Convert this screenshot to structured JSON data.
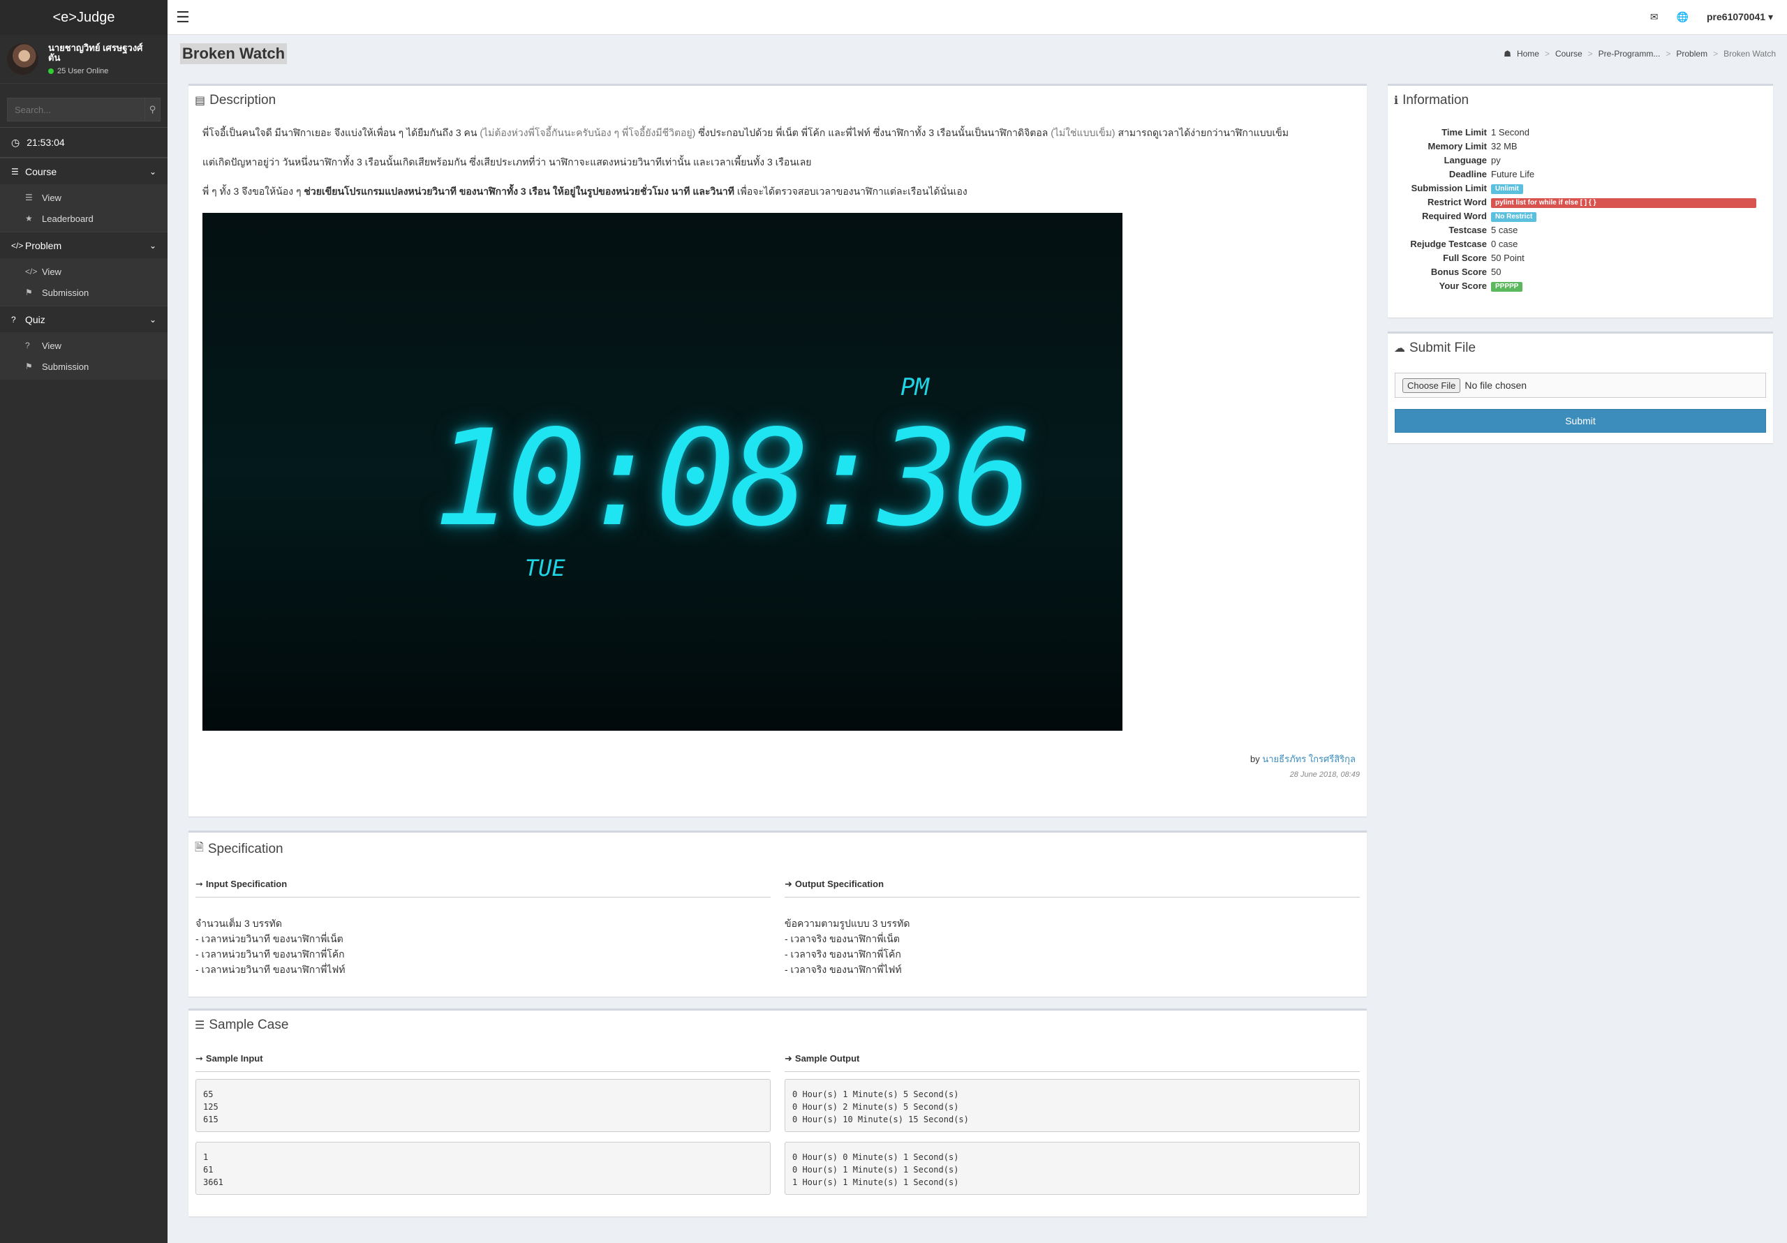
{
  "sidebar": {
    "brand": "<e>Judge",
    "user_name_line1": "นายชาญวิทย์ เศรษฐวงศ์",
    "user_name_line2": "ตัน",
    "online": "25 User Online",
    "search_placeholder": "Search...",
    "clock": "21:53:04",
    "menus": [
      {
        "label": "Course",
        "items": [
          "View",
          "Leaderboard"
        ]
      },
      {
        "label": "Problem",
        "items": [
          "View",
          "Submission"
        ]
      },
      {
        "label": "Quiz",
        "items": [
          "View",
          "Submission"
        ]
      }
    ]
  },
  "topbar": {
    "username": "pre61070041"
  },
  "page": {
    "title": "Broken Watch",
    "breadcrumb": [
      "Home",
      "Course",
      "Pre-Programm...",
      "Problem",
      "Broken Watch"
    ]
  },
  "description": {
    "heading": "Description",
    "p1_a": "พี่โจอี้เป็นคนใจดี มีนาฬิกาเยอะ จึงแบ่งให้เพื่อน ๆ ได้ยืมกันถึง 3 คน ",
    "p1_b": "(ไม่ต้องห่วงพี่โจอี้กันนะครับน้อง ๆ พี่โจอี้ยังมีชีวิตอยู่)",
    "p1_c": " ซึ่งประกอบไปด้วย พี่เน็ต พี่โค้ก และพี่ไฟท์ ซึ่งนาฬิกาทั้ง 3 เรือนนั้นเป็นนาฬิกาดิจิตอล ",
    "p1_d": "(ไม่ใช่แบบเข็ม)",
    "p1_e": " สามารถดูเวลาได้ง่ายกว่านาฬิกาแบบเข็ม",
    "p2": "แต่เกิดปัญหาอยู่ว่า วันหนึ่งนาฬิกาทั้ง 3 เรือนนั้นเกิดเสียพร้อมกัน ซึ่งเสียประเภทที่ว่า นาฬิกาจะแสดงหน่วยวินาทีเท่านั้น และเวลาเพี้ยนทั้ง 3 เรือนเลย",
    "p3_a": "พี่ ๆ ทั้ง 3 จึงขอให้น้อง ๆ ",
    "p3_b": "ช่วยเขียนโปรแกรมแปลงหน่วยวินาที ของนาฬิกาทั้ง 3 เรือน ให้อยู่ในรูปของหน่วยชั่วโมง นาที และวินาที",
    "p3_c": " เพื่อจะได้ตรวจสอบเวลาของนาฬิกาแต่ละเรือนได้นั่นเอง",
    "watch_time": "10:08:36",
    "watch_pm": "PM",
    "watch_day": "TUE",
    "author_prefix": "by ",
    "author": "นายธีรภัทร ใกรศรีสิริกุล",
    "date": "28 June 2018, 08:49"
  },
  "information": {
    "heading": "Information",
    "rows": [
      {
        "k": "Time Limit",
        "v": "1 Second"
      },
      {
        "k": "Memory Limit",
        "v": "32 MB"
      },
      {
        "k": "Language",
        "v": "py"
      },
      {
        "k": "Deadline",
        "v": "Future Life"
      },
      {
        "k": "Submission Limit",
        "v": "Unlimit",
        "badge": "blue"
      },
      {
        "k": "Restrict Word",
        "v": "pylint list for while if else [ ] { }",
        "badge": "red"
      },
      {
        "k": "Required Word",
        "v": "No Restrict",
        "badge": "blue"
      },
      {
        "k": "Testcase",
        "v": "5 case"
      },
      {
        "k": "Rejudge Testcase",
        "v": "0 case"
      },
      {
        "k": "Full Score",
        "v": "50 Point"
      },
      {
        "k": "Bonus Score",
        "v": "50"
      },
      {
        "k": "Your Score",
        "v": "PPPPP",
        "badge": "green"
      }
    ]
  },
  "submit": {
    "heading": "Submit File",
    "choose": "Choose File",
    "no_file": "No file chosen",
    "button": "Submit"
  },
  "specification": {
    "heading": "Specification",
    "input_head": "Input Specification",
    "output_head": "Output Specification",
    "input_lines": [
      "จำนวนเต็ม 3 บรรทัด",
      "- เวลาหน่วยวินาที ของนาฬิกาพี่เน็ต",
      "- เวลาหน่วยวินาที ของนาฬิกาพี่โค้ก",
      "- เวลาหน่วยวินาที ของนาฬิกาพี่ไฟท์"
    ],
    "output_lines": [
      "ข้อความตามรูปแบบ 3 บรรทัด",
      "- เวลาจริง ของนาฬิกาพี่เน็ต",
      "- เวลาจริง ของนาฬิกาพี่โค้ก",
      "- เวลาจริง ของนาฬิกาพี่ไฟท์"
    ]
  },
  "sample": {
    "heading": "Sample Case",
    "input_head": "Sample Input",
    "output_head": "Sample Output",
    "in1": "65\n125\n615",
    "out1": "0 Hour(s) 1 Minute(s) 5 Second(s)\n0 Hour(s) 2 Minute(s) 5 Second(s)\n0 Hour(s) 10 Minute(s) 15 Second(s)",
    "in2": "1\n61\n3661",
    "out2": "0 Hour(s) 0 Minute(s) 1 Second(s)\n0 Hour(s) 1 Minute(s) 1 Second(s)\n1 Hour(s) 1 Minute(s) 1 Second(s)"
  }
}
